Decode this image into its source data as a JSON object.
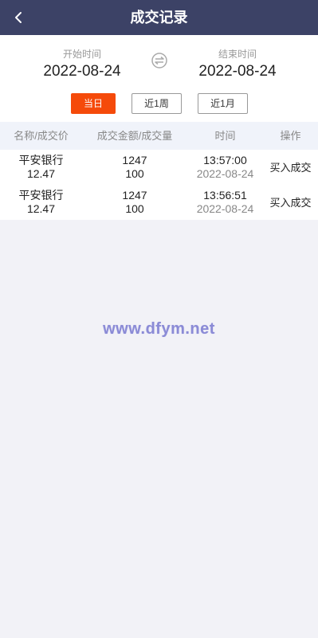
{
  "header": {
    "title": "成交记录",
    "back_icon": "chevron-left-icon"
  },
  "filter": {
    "start_label": "开始时间",
    "start_value": "2022-08-24",
    "end_label": "结束时间",
    "end_value": "2022-08-24",
    "swap_icon": "swap-icon",
    "ranges": [
      "当日",
      "近1周",
      "近1月"
    ],
    "active_range": "当日",
    "accent_color": "#f54a0a"
  },
  "table": {
    "headers": [
      "名称/成交价",
      "成交金额/成交量",
      "时间",
      "操作"
    ],
    "rows": [
      {
        "name": "平安银行",
        "price": "12.47",
        "amount": "1247",
        "volume": "100",
        "time": "13:57:00",
        "date": "2022-08-24",
        "action": "买入成交"
      },
      {
        "name": "平安银行",
        "price": "12.47",
        "amount": "1247",
        "volume": "100",
        "time": "13:56:51",
        "date": "2022-08-24",
        "action": "买入成交"
      }
    ]
  },
  "watermark": "www.dfym.net",
  "colors": {
    "header_bg": "#3c4266",
    "table_head_bg": "#f0f3fa",
    "page_bg": "#f2f2f7"
  }
}
